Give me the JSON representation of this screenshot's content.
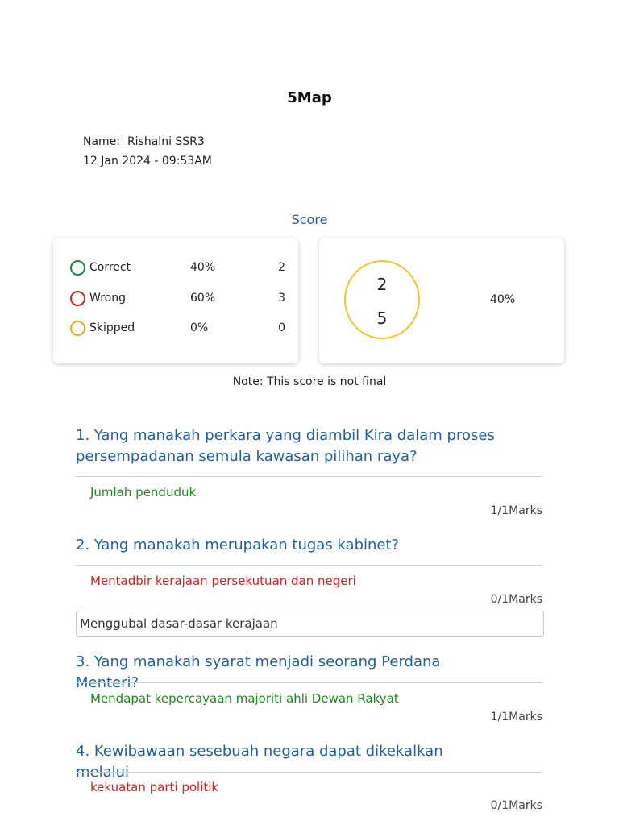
{
  "header": {
    "title": "5Map",
    "name_label": "Name:",
    "name_value": "Rishalni SSR3",
    "datetime": "12 Jan 2024 - 09:53AM"
  },
  "score": {
    "label": "Score",
    "rows": [
      {
        "label": "Correct",
        "percent": "40%",
        "count": "2",
        "color": "#1b8a3a"
      },
      {
        "label": "Wrong",
        "percent": "60%",
        "count": "3",
        "color": "#e31b1b"
      },
      {
        "label": "Skipped",
        "percent": "0%",
        "count": "0",
        "color": "#f5a623"
      }
    ],
    "circle": {
      "numerator": "2",
      "denominator": "5",
      "color": "#f6c42a"
    },
    "percent": "40%",
    "note": "Note: This score is not final"
  },
  "questions": [
    {
      "question": "1. Yang manakah perkara yang diambil Kira dalam proses persempadanan semula kawasan pilihan raya?",
      "answer": "Jumlah penduduk",
      "status": "correct",
      "marks": "1/1Marks"
    },
    {
      "question": "2. Yang manakah merupakan tugas kabinet?",
      "answer": "Mentadbir kerajaan persekutuan dan negeri",
      "status": "wrong",
      "marks": "0/1Marks",
      "correct_answer": "Menggubal dasar-dasar kerajaan"
    },
    {
      "question": "3. Yang manakah syarat menjadi seorang Perdana Menteri?",
      "answer": "Mendapat kepercayaan majoriti ahli Dewan Rakyat",
      "status": "correct",
      "marks": "1/1Marks"
    },
    {
      "question": "4. Kewibawaan sesebuah negara dapat dikekalkan melalui",
      "answer": "kekuatan parti politik",
      "status": "wrong",
      "marks": "0/1Marks"
    }
  ]
}
